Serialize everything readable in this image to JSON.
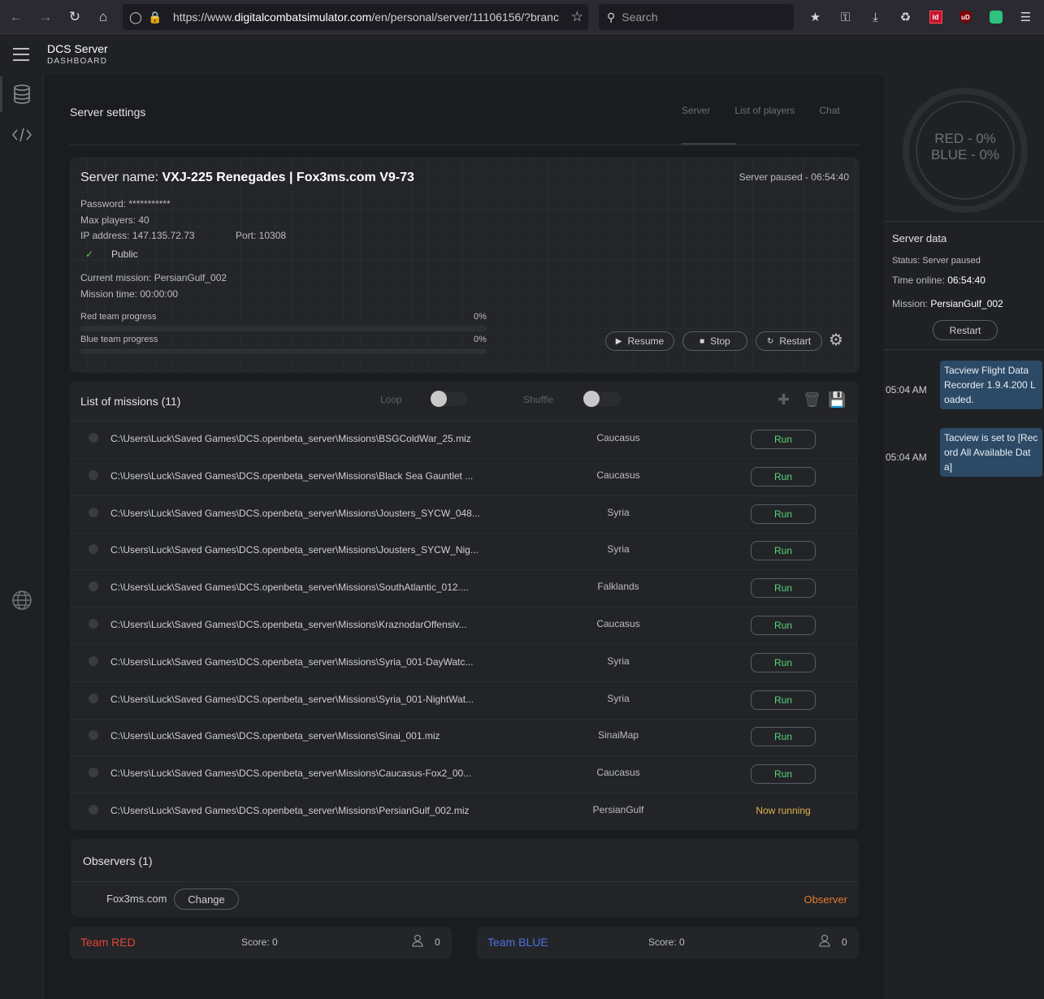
{
  "browser": {
    "url_prefix": "https://www.",
    "url_host": "digitalcombatsimulator.com",
    "url_path": "/en/personal/server/11106156/?branc",
    "search_placeholder": "Search",
    "ext_id_label": "id",
    "ext_ub_label": "uD"
  },
  "app": {
    "title": "DCS Server",
    "subtitle": "DASHBOARD"
  },
  "page": {
    "title": "Server settings",
    "tabs": [
      "Server",
      "List of players",
      "Chat"
    ]
  },
  "server": {
    "name_label": "Server name: ",
    "name_value": "VXJ-225 Renegades | Fox3ms.com V9-73",
    "status": "Server paused - 06:54:40",
    "password": "Password: ***********",
    "max_players": "Max players: 40",
    "ip": "IP address: 147.135.72.73",
    "port": "Port: 10308",
    "public_label": "Public",
    "current_mission": "Current mission: PersianGulf_002",
    "mission_time": "Mission time: 00:00:00",
    "red_progress_label": "Red team progress",
    "red_progress_value": "0%",
    "red_progress_fraction": 0,
    "blue_progress_label": "Blue team progress",
    "blue_progress_value": "0%",
    "blue_progress_fraction": 0,
    "buttons": {
      "resume": "Resume",
      "stop": "Stop",
      "restart": "Restart"
    }
  },
  "missions": {
    "title": "List of missions (11)",
    "loop_label": "Loop",
    "shuffle_label": "Shuffle",
    "run_label": "Run",
    "running_label": "Now running",
    "items": [
      {
        "path": "C:\\Users\\Luck\\Saved Games\\DCS.openbeta_server\\Missions\\BSGColdWar_25.miz",
        "map": "Caucasus",
        "state": "run"
      },
      {
        "path": "C:\\Users\\Luck\\Saved Games\\DCS.openbeta_server\\Missions\\Black Sea Gauntlet ...",
        "map": "Caucasus",
        "state": "run"
      },
      {
        "path": "C:\\Users\\Luck\\Saved Games\\DCS.openbeta_server\\Missions\\Jousters_SYCW_048...",
        "map": "Syria",
        "state": "run"
      },
      {
        "path": "C:\\Users\\Luck\\Saved Games\\DCS.openbeta_server\\Missions\\Jousters_SYCW_Nig...",
        "map": "Syria",
        "state": "run"
      },
      {
        "path": "C:\\Users\\Luck\\Saved Games\\DCS.openbeta_server\\Missions\\SouthAtlantic_012....",
        "map": "Falklands",
        "state": "run"
      },
      {
        "path": "C:\\Users\\Luck\\Saved Games\\DCS.openbeta_server\\Missions\\KraznodarOffensiv...",
        "map": "Caucasus",
        "state": "run"
      },
      {
        "path": "C:\\Users\\Luck\\Saved Games\\DCS.openbeta_server\\Missions\\Syria_001-DayWatc...",
        "map": "Syria",
        "state": "run"
      },
      {
        "path": "C:\\Users\\Luck\\Saved Games\\DCS.openbeta_server\\Missions\\Syria_001-NightWat...",
        "map": "Syria",
        "state": "run"
      },
      {
        "path": "C:\\Users\\Luck\\Saved Games\\DCS.openbeta_server\\Missions\\Sinai_001.miz",
        "map": "SinaiMap",
        "state": "run"
      },
      {
        "path": "C:\\Users\\Luck\\Saved Games\\DCS.openbeta_server\\Missions\\Caucasus-Fox2_00...",
        "map": "Caucasus",
        "state": "run"
      },
      {
        "path": "C:\\Users\\Luck\\Saved Games\\DCS.openbeta_server\\Missions\\PersianGulf_002.miz",
        "map": "PersianGulf",
        "state": "running"
      }
    ]
  },
  "observers": {
    "title": "Observers (1)",
    "name": "Fox3ms.com",
    "change_label": "Change",
    "role": "Observer"
  },
  "teams": {
    "red": {
      "name": "Team RED",
      "score": "Score: 0",
      "count": "0",
      "color": "#e0453a"
    },
    "blue": {
      "name": "Team BLUE",
      "score": "Score: 0",
      "count": "0",
      "color": "#4f6fe6"
    }
  },
  "right_panel": {
    "red_pct": "RED - 0%",
    "blue_pct": "BLUE - 0%",
    "title": "Server data",
    "status": "Status: Server paused",
    "time_label": "Time online: ",
    "time_value": "06:54:40",
    "mission_label": "Mission: ",
    "mission_value": "PersianGulf_002",
    "restart_label": "Restart",
    "chat": [
      {
        "time": "05:04 AM",
        "text": "Tacview Flight Data Recorder 1.9.4.200 Loaded."
      },
      {
        "time": "05:04 AM",
        "text": "Tacview is set to [Record All Available Data]"
      }
    ]
  }
}
